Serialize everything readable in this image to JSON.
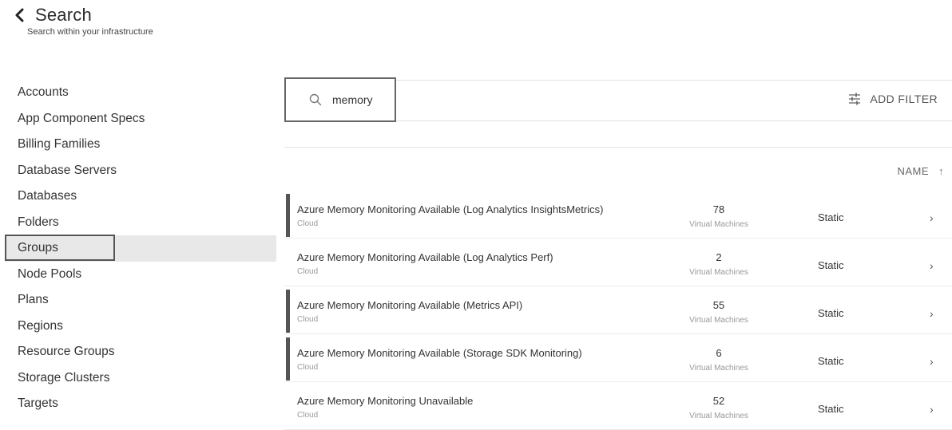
{
  "header": {
    "title": "Search",
    "subtitle": "Search within your infrastructure",
    "back_icon": "chevron-left-icon"
  },
  "sidebar": {
    "active_index": 6,
    "items": [
      {
        "label": "Accounts"
      },
      {
        "label": "App Component Specs"
      },
      {
        "label": "Billing Families"
      },
      {
        "label": "Database Servers"
      },
      {
        "label": "Databases"
      },
      {
        "label": "Folders"
      },
      {
        "label": "Groups"
      },
      {
        "label": "Node Pools"
      },
      {
        "label": "Plans"
      },
      {
        "label": "Regions"
      },
      {
        "label": "Resource Groups"
      },
      {
        "label": "Storage Clusters"
      },
      {
        "label": "Targets"
      }
    ]
  },
  "search": {
    "value": "memory",
    "icon": "search-icon",
    "add_filter_label": "ADD FILTER",
    "filter_icon": "filter-sliders-icon"
  },
  "results": {
    "sort_label": "NAME",
    "sort_direction_icon": "arrow-up-icon",
    "rows": [
      {
        "name": "Azure Memory Monitoring Available (Log Analytics InsightsMetrics)",
        "category": "Cloud",
        "count": "78",
        "count_label": "Virtual Machines",
        "type": "Static",
        "highlighted": true
      },
      {
        "name": "Azure Memory Monitoring Available (Log Analytics Perf)",
        "category": "Cloud",
        "count": "2",
        "count_label": "Virtual Machines",
        "type": "Static",
        "highlighted": false
      },
      {
        "name": "Azure Memory Monitoring Available (Metrics API)",
        "category": "Cloud",
        "count": "55",
        "count_label": "Virtual Machines",
        "type": "Static",
        "highlighted": true
      },
      {
        "name": "Azure Memory Monitoring Available (Storage SDK Monitoring)",
        "category": "Cloud",
        "count": "6",
        "count_label": "Virtual Machines",
        "type": "Static",
        "highlighted": true
      },
      {
        "name": "Azure Memory Monitoring Unavailable",
        "category": "Cloud",
        "count": "52",
        "count_label": "Virtual Machines",
        "type": "Static",
        "highlighted": false
      }
    ]
  }
}
